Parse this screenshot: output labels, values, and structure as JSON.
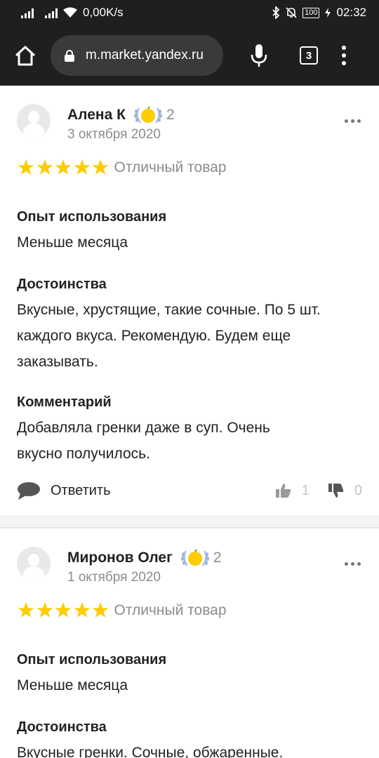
{
  "status_bar": {
    "network_speed": "0,00K/s",
    "battery": "100",
    "time": "02:32"
  },
  "browser": {
    "url": "m.market.yandex.ru",
    "tab_count": "3"
  },
  "reviews": [
    {
      "author": "Алена К",
      "badge_count": "2",
      "date": "3 октября 2020",
      "stars": 5,
      "rating_label": "Отличный товар",
      "sections": [
        {
          "title": "Опыт использования",
          "text": "Меньше месяца"
        },
        {
          "title": "Достоинства",
          "text": "Вкусные, хрустящие, такие сочные. По 5 шт. каждого вкуса. Рекомендую. Будем еще заказывать."
        },
        {
          "title": "Комментарий",
          "text": "Добавляла гренки даже в суп. Очень вкусно получилось."
        }
      ],
      "reply_label": "Ответить",
      "likes": "1",
      "dislikes": "0"
    },
    {
      "author": "Миронов Олег",
      "badge_count": "2",
      "date": "1 октября 2020",
      "stars": 5,
      "rating_label": "Отличный товар",
      "sections": [
        {
          "title": "Опыт использования",
          "text": "Меньше месяца"
        },
        {
          "title": "Достоинства",
          "text": "Вкусные гренки. Сочные, обжаренные."
        }
      ]
    }
  ],
  "colors": {
    "star": "#ffcc00",
    "badge": "#ffcc00",
    "laurel": "#9fb3d8",
    "muted": "#8c8c8c",
    "chrome": "#1f1f1f"
  }
}
